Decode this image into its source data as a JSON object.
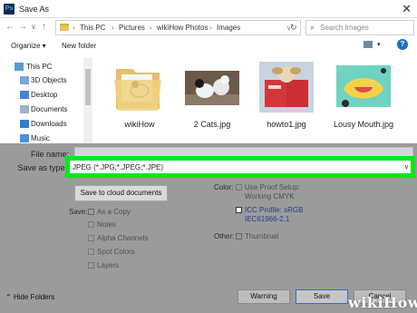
{
  "window": {
    "app_icon": "Ps",
    "title": "Save As",
    "close_glyph": "✕"
  },
  "nav": {
    "back_glyph": "←",
    "forward_glyph": "→",
    "recent_glyph": "∨",
    "up_glyph": "↑",
    "breadcrumb": [
      "This PC",
      "Pictures",
      "wikiHow Photos",
      "Images"
    ],
    "separator": "›",
    "refresh_glyph": "↻",
    "search_placeholder": "Search Images",
    "search_glyph": "⌕"
  },
  "toolbar": {
    "organize_label": "Organize ▾",
    "new_folder_label": "New folder",
    "help_glyph": "?"
  },
  "sidebar": {
    "items": [
      {
        "label": "This PC",
        "icon": "computer-icon"
      },
      {
        "label": "3D Objects",
        "icon": "cube-icon"
      },
      {
        "label": "Desktop",
        "icon": "desktop-icon"
      },
      {
        "label": "Documents",
        "icon": "document-icon"
      },
      {
        "label": "Downloads",
        "icon": "download-icon"
      },
      {
        "label": "Music",
        "icon": "music-icon"
      }
    ]
  },
  "files": [
    {
      "name": "wikiHow",
      "kind": "folder"
    },
    {
      "name": "2 Cats.jpg",
      "kind": "image"
    },
    {
      "name": "howto1.jpg",
      "kind": "image"
    },
    {
      "name": "Lousy Mouth.jpg",
      "kind": "image"
    }
  ],
  "form": {
    "file_name_label": "File name:",
    "save_as_type_label": "Save as type:",
    "save_as_type_value": "JPEG (*.JPG;*.JPEG;*.JPE)",
    "cloud_button": "Save to cloud documents"
  },
  "save_options": {
    "label": "Save:",
    "items": [
      "As a Copy",
      "Notes",
      "Alpha Channels",
      "Spot Colors",
      "Layers"
    ]
  },
  "color_options": {
    "label": "Color:",
    "use_proof_line1": "Use Proof Setup:",
    "use_proof_line2": "Working CMYK",
    "icc_label": "ICC Profile:  sRGB",
    "icc_value": "IEC61966-2.1",
    "other_label": "Other:",
    "thumbnail": "Thumbnail"
  },
  "footer": {
    "hide_folders": "Hide Folders",
    "warning_button": "Warning",
    "save_button": "Save",
    "cancel_button": "Cancel",
    "watermark": "wikiHow"
  },
  "colors": {
    "highlight": "#00e91a",
    "overlay": "#9b9b9b"
  }
}
